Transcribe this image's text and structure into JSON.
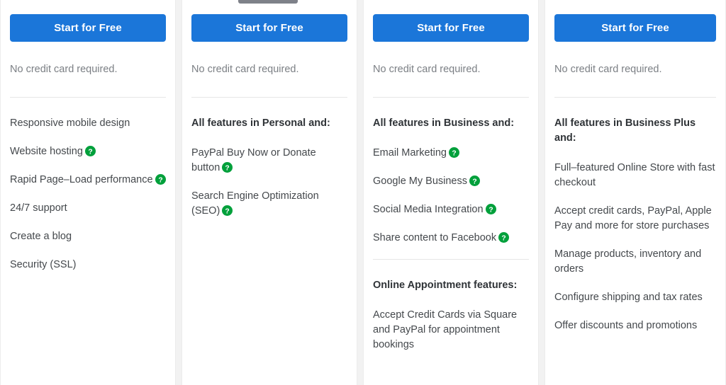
{
  "page": {
    "background_color": "#f2f2f2",
    "card_background": "#ffffff",
    "accent_color": "#1b76d9",
    "help_icon_color": "#00a03b",
    "divider_color": "#e6e6e6",
    "note_text_color": "#7b7f84",
    "feature_text_color": "#44484c"
  },
  "top_indicator": {
    "name": "scroll-indicator-bar",
    "color": "#7e8189"
  },
  "icons": {
    "help": "help-question-icon"
  },
  "columns": [
    {
      "plan_key": "personal",
      "cta_label": "Start for Free",
      "note": "No credit card required.",
      "sections": [
        {
          "divider_above": false,
          "items": [
            {
              "text": "Responsive mobile design",
              "heading": false,
              "help": false
            },
            {
              "text": "Website hosting",
              "heading": false,
              "help": true
            },
            {
              "text": "Rapid Page–Load performance",
              "heading": false,
              "help": true
            },
            {
              "text": "24/7 support",
              "heading": false,
              "help": false
            },
            {
              "text": "Create a blog",
              "heading": false,
              "help": false
            },
            {
              "text": "Security (SSL)",
              "heading": false,
              "help": false
            }
          ]
        }
      ]
    },
    {
      "plan_key": "business",
      "cta_label": "Start for Free",
      "note": "No credit card required.",
      "sections": [
        {
          "divider_above": false,
          "items": [
            {
              "text": "All features in Personal and:",
              "heading": true,
              "help": false
            },
            {
              "text": "PayPal Buy Now or Donate button",
              "heading": false,
              "help": true
            },
            {
              "text": "Search Engine Optimization (SEO)",
              "heading": false,
              "help": true
            }
          ]
        }
      ]
    },
    {
      "plan_key": "business-plus",
      "cta_label": "Start for Free",
      "note": "No credit card required.",
      "sections": [
        {
          "divider_above": false,
          "items": [
            {
              "text": "All features in Business and:",
              "heading": true,
              "help": false
            },
            {
              "text": "Email Marketing",
              "heading": false,
              "help": true
            },
            {
              "text": "Google My Business",
              "heading": false,
              "help": true
            },
            {
              "text": "Social Media Integration",
              "heading": false,
              "help": true
            },
            {
              "text": "Share content to Facebook",
              "heading": false,
              "help": true
            }
          ]
        },
        {
          "divider_above": true,
          "items": [
            {
              "text": "Online Appointment features:",
              "heading": true,
              "help": false
            },
            {
              "text": "Accept Credit Cards via Square and PayPal for appointment bookings",
              "heading": false,
              "help": false
            }
          ]
        }
      ]
    },
    {
      "plan_key": "online-store",
      "cta_label": "Start for Free",
      "note": "No credit card required.",
      "sections": [
        {
          "divider_above": false,
          "items": [
            {
              "text": "All features in Business Plus and:",
              "heading": true,
              "help": false
            },
            {
              "text": "Full–featured Online Store with fast checkout",
              "heading": false,
              "help": false
            },
            {
              "text": "Accept credit cards, PayPal, Apple Pay and more for store purchases",
              "heading": false,
              "help": false
            },
            {
              "text": "Manage products, inventory and orders",
              "heading": false,
              "help": false
            },
            {
              "text": "Configure shipping and tax rates",
              "heading": false,
              "help": false
            },
            {
              "text": "Offer discounts and promotions",
              "heading": false,
              "help": false
            }
          ]
        }
      ]
    }
  ]
}
